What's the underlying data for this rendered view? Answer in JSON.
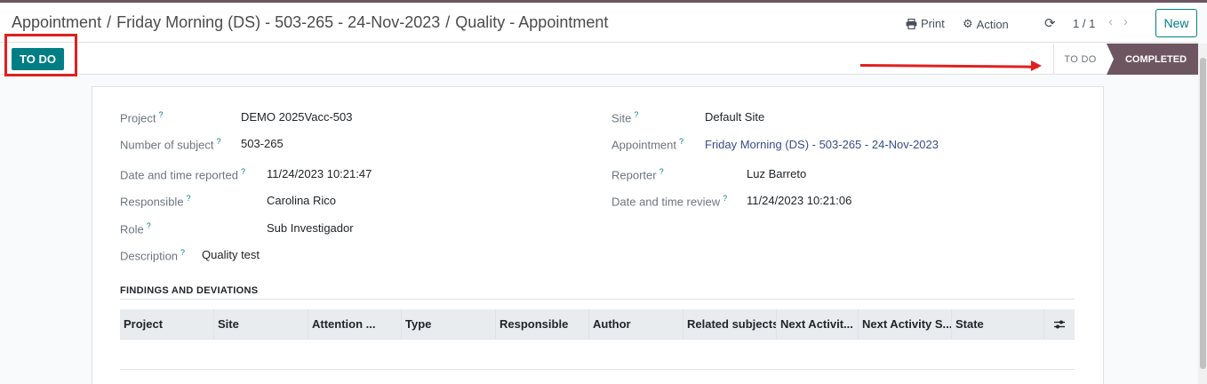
{
  "breadcrumb": [
    "Appointment",
    "Friday Morning (DS) - 503-265 - 24-Nov-2023",
    "Quality - Appointment"
  ],
  "breadcrumb_separator": "/",
  "header": {
    "print_label": "Print",
    "action_label": "Action",
    "pager": "1 / 1",
    "new_label": "New"
  },
  "statusbar": {
    "todo_button": "TO DO",
    "stages": [
      "TO DO",
      "COMPLETED"
    ],
    "active_stage": "COMPLETED"
  },
  "form": {
    "project_label": "Project",
    "project_value": "DEMO 2025Vacc-503",
    "subject_label": "Number of subject",
    "subject_value": "503-265",
    "reported_label": "Date and time reported",
    "reported_value": "11/24/2023 10:21:47",
    "responsible_label": "Responsible",
    "responsible_value": "Carolina Rico",
    "role_label": "Role",
    "role_value": "Sub Investigador",
    "description_label": "Description",
    "description_value": "Quality test",
    "site_label": "Site",
    "site_value": "Default Site",
    "appointment_label": "Appointment",
    "appointment_value": "Friday Morning (DS) - 503-265 - 24-Nov-2023",
    "reporter_label": "Reporter",
    "reporter_value": "Luz Barreto",
    "review_label": "Date and time review",
    "review_value": "11/24/2023 10:21:06",
    "help_mark": "?"
  },
  "findings": {
    "title": "FINDINGS AND DEVIATIONS",
    "columns": [
      "Project",
      "Site",
      "Attention ...",
      "Type",
      "Responsible",
      "Author",
      "Related subjects",
      "Next Activit...",
      "Next Activity S...",
      "State"
    ]
  },
  "colors": {
    "primary": "#017e84",
    "stage_active": "#6e5661",
    "annotation": "#e02020"
  },
  "icons": [
    "printer-icon",
    "gear-icon",
    "refresh-icon",
    "chevron-left-icon",
    "chevron-right-icon",
    "column-settings-icon"
  ]
}
